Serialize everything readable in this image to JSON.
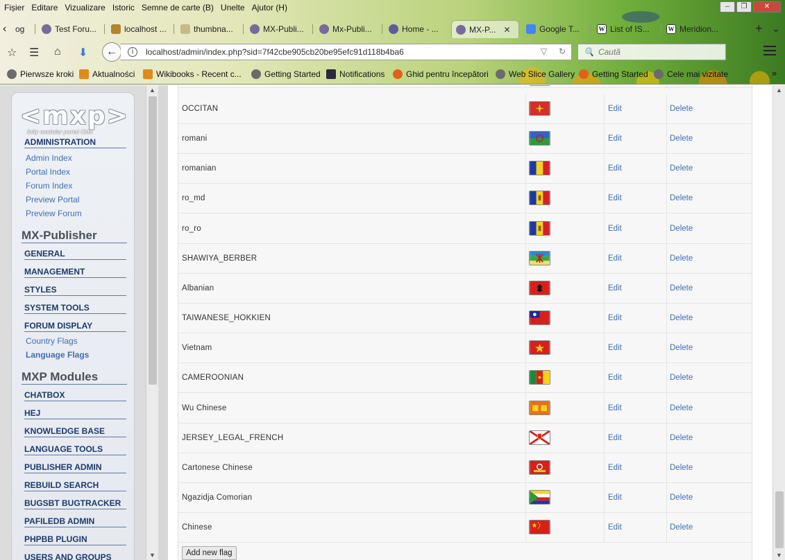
{
  "menubar": [
    "Fișier",
    "Editare",
    "Vizualizare",
    "Istoric",
    "Semne de carte (B)",
    "Unelte",
    "Ajutor (H)"
  ],
  "tabs": [
    {
      "label": "og",
      "icon": "none"
    },
    {
      "label": "Test Foru...",
      "icon": "gear"
    },
    {
      "label": "localhost ...",
      "icon": "php"
    },
    {
      "label": "thumbna...",
      "icon": "image"
    },
    {
      "label": "MX-Publi...",
      "icon": "gear"
    },
    {
      "label": "Mx-Publi...",
      "icon": "gear"
    },
    {
      "label": "Home - ...",
      "icon": "gear"
    },
    {
      "label": "MX-P...",
      "icon": "gear",
      "active": true
    },
    {
      "label": "Google T...",
      "icon": "google"
    },
    {
      "label": "List of IS...",
      "icon": "wiki"
    },
    {
      "label": "Meridion...",
      "icon": "wiki"
    }
  ],
  "url": "localhost/admin/index.php?sid=7f42cbe905cb20be95efc91d118b4ba6",
  "search_placeholder": "Caută",
  "bookmarks": [
    {
      "label": "Pierwsze kroki",
      "icon": "globe"
    },
    {
      "label": "Aktualności",
      "icon": "rss"
    },
    {
      "label": "Wikibooks - Recent c...",
      "icon": "rss"
    },
    {
      "label": "Getting Started",
      "icon": "globe"
    },
    {
      "label": "Notifications",
      "icon": "dark"
    },
    {
      "label": "Ghid pentru începători",
      "icon": "firefox"
    },
    {
      "label": "Web Slice Gallery",
      "icon": "globe"
    },
    {
      "label": "Getting Started",
      "icon": "firefox"
    },
    {
      "label": "Cele mai vizitate",
      "icon": "globe"
    }
  ],
  "sidebar": {
    "logo_text": "<mxp>",
    "logo_sub": "fully modular portal   CMS",
    "administration": {
      "title": "ADMINISTRATION",
      "links": [
        "Admin Index",
        "Portal Index",
        "Forum Index",
        "Preview Portal",
        "Preview Forum"
      ]
    },
    "mx_publisher": {
      "title": "MX-Publisher",
      "sections": [
        "GENERAL",
        "MANAGEMENT",
        "STYLES",
        "SYSTEM TOOLS",
        "FORUM DISPLAY"
      ],
      "forum_display_links": [
        {
          "label": "Country Flags",
          "bold": false
        },
        {
          "label": "Language Flags",
          "bold": true
        }
      ]
    },
    "mxp_modules": {
      "title": "MXP Modules",
      "sections": [
        "CHATBOX",
        "HEJ",
        "KNOWLEDGE BASE",
        "LANGUAGE TOOLS",
        "PUBLISHER ADMIN",
        "REBUILD SEARCH",
        "BUGSBT BUGTRACKER",
        "PAFILEDB ADMIN",
        "PHPBB PLUGIN",
        "USERS AND GROUPS"
      ]
    }
  },
  "flags_table": {
    "edit_label": "Edit",
    "delete_label": "Delete",
    "rows": [
      {
        "name": "OCCITAN",
        "flag": "occitan"
      },
      {
        "name": "romani",
        "flag": "romani"
      },
      {
        "name": "romanian",
        "flag": "romanian"
      },
      {
        "name": "ro_md",
        "flag": "moldova"
      },
      {
        "name": "ro_ro",
        "flag": "moldova"
      },
      {
        "name": "SHAWIYA_BERBER",
        "flag": "berber"
      },
      {
        "name": "Albanian",
        "flag": "albania"
      },
      {
        "name": "TAIWANESE_HOKKIEN",
        "flag": "taiwan"
      },
      {
        "name": "Vietnam",
        "flag": "vietnam"
      },
      {
        "name": "CAMEROONIAN",
        "flag": "cameroon"
      },
      {
        "name": "Wu Chinese",
        "flag": "wu"
      },
      {
        "name": "JERSEY_LEGAL_FRENCH",
        "flag": "jersey"
      },
      {
        "name": "Cartonese Chinese",
        "flag": "hongkong"
      },
      {
        "name": "Ngazidja Comorian",
        "flag": "comoros"
      },
      {
        "name": "Chinese",
        "flag": "china"
      }
    ],
    "add_button": "Add new flag"
  }
}
